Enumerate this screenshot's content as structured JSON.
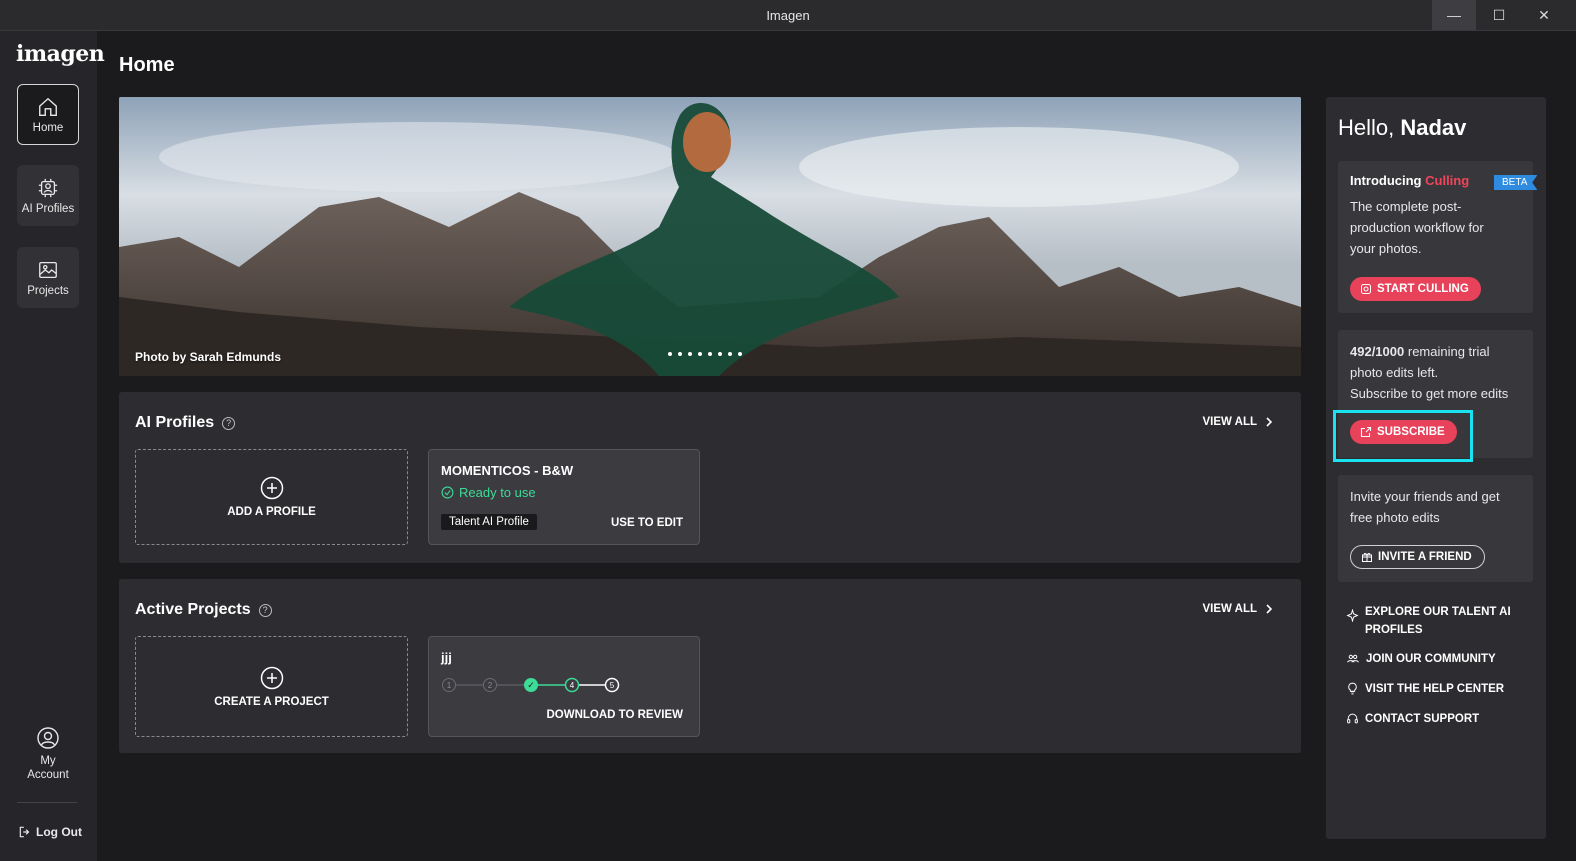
{
  "window": {
    "title": "Imagen",
    "min": "—",
    "max": "☐",
    "close": "✕"
  },
  "sidebar": {
    "logo": "imagen",
    "items": [
      {
        "label": "Home",
        "icon": "home-icon"
      },
      {
        "label": "AI Profiles",
        "icon": "ai-chip-icon"
      },
      {
        "label": "Projects",
        "icon": "image-icon"
      }
    ],
    "account_line1": "My",
    "account_line2": "Account",
    "logout": "Log Out"
  },
  "main": {
    "title": "Home",
    "hero": {
      "credit": "Photo by Sarah Edmunds",
      "slide_count": 8
    },
    "ai_profiles": {
      "title": "AI Profiles",
      "view_all": "VIEW ALL",
      "add_label": "ADD A PROFILE",
      "card": {
        "name": "MOMENTICOS - B&W",
        "status": "Ready to use",
        "tag": "Talent AI Profile",
        "action": "USE TO EDIT"
      }
    },
    "projects": {
      "title": "Active Projects",
      "view_all": "VIEW ALL",
      "create_label": "CREATE A PROJECT",
      "card": {
        "name": "jjj",
        "steps": [
          "1",
          "2",
          "✓",
          "4",
          "5"
        ],
        "action": "DOWNLOAD TO REVIEW"
      }
    }
  },
  "right": {
    "hello": "Hello,",
    "user": "Nadav",
    "culling": {
      "intro": "Introducing",
      "feature": "Culling",
      "badge": "BETA",
      "line1": "The complete post-",
      "line2": "production workflow for",
      "line3": "your photos.",
      "button": "START CULLING"
    },
    "trial": {
      "count": "492/1000",
      "text1": "remaining trial",
      "line2": "photo edits left.",
      "line3": "Subscribe to get more edits",
      "button": "SUBSCRIBE"
    },
    "invite": {
      "line1": "Invite your friends and get",
      "line2": "free photo edits",
      "button": "INVITE A FRIEND"
    },
    "links": {
      "explore1": "EXPLORE OUR TALENT AI",
      "explore2": "PROFILES",
      "community": "JOIN OUR COMMUNITY",
      "help": "VISIT THE HELP CENTER",
      "support": "CONTACT SUPPORT"
    }
  },
  "colors": {
    "accent_red": "#e8425a",
    "ready_green": "#3ddc97",
    "beta_blue": "#2f8be0",
    "highlight_cyan": "#19e3f0"
  }
}
